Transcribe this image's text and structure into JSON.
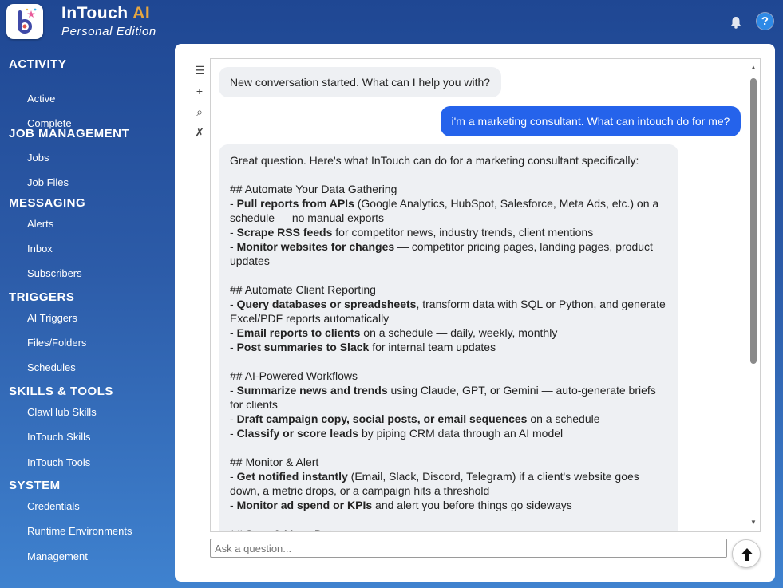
{
  "app": {
    "title": "InTouch",
    "title_ai": "AI",
    "edition": "Personal Edition",
    "help_label": "?",
    "colors": {
      "accent": "#e6a640",
      "user_bubble": "#2563eb",
      "help": "#2e8ae6"
    }
  },
  "sidebar": {
    "sections": [
      {
        "title": "ACTIVITY",
        "items": [
          "Active",
          "Complete"
        ]
      },
      {
        "title": "JOB MANAGEMENT",
        "items": [
          "Jobs",
          "Job Files"
        ]
      },
      {
        "title": "MESSAGING",
        "items": [
          "Alerts",
          "Inbox",
          "Subscribers"
        ]
      },
      {
        "title": "TRIGGERS",
        "items": [
          "AI Triggers",
          "Files/Folders",
          "Schedules"
        ]
      },
      {
        "title": "SKILLS & TOOLS",
        "items": [
          "ClawHub Skills",
          "InTouch Skills",
          "InTouch Tools"
        ]
      },
      {
        "title": "SYSTEM",
        "items": [
          "Credentials",
          "Runtime Environments",
          "Management"
        ]
      }
    ]
  },
  "toolbar": {
    "icons": [
      {
        "name": "menu-icon",
        "glyph": "☰"
      },
      {
        "name": "plus-icon",
        "glyph": "+"
      },
      {
        "name": "search-icon",
        "glyph": "⌕"
      },
      {
        "name": "clear-icon",
        "glyph": "✗"
      }
    ]
  },
  "chat": {
    "system_message": "New conversation started. What can I help you with?",
    "user_message": "i'm a marketing consultant. What can intouch do for me?",
    "ai_lines": [
      [
        {
          "t": "Great question. Here's what InTouch can do for a marketing consultant specifically:"
        }
      ],
      [],
      [
        {
          "t": "## Automate Your Data Gathering"
        }
      ],
      [
        {
          "t": "- "
        },
        {
          "t": "Pull reports from APIs",
          "b": true
        },
        {
          "t": " (Google Analytics, HubSpot, Salesforce, Meta Ads, etc.) on a"
        }
      ],
      [
        {
          "t": "schedule — no manual exports"
        }
      ],
      [
        {
          "t": "- "
        },
        {
          "t": "Scrape RSS feeds",
          "b": true
        },
        {
          "t": " for competitor news, industry trends, client mentions"
        }
      ],
      [
        {
          "t": "- "
        },
        {
          "t": "Monitor websites for changes",
          "b": true
        },
        {
          "t": " — competitor pricing pages, landing pages, product"
        }
      ],
      [
        {
          "t": "updates"
        }
      ],
      [],
      [
        {
          "t": "## Automate Client Reporting"
        }
      ],
      [
        {
          "t": "- "
        },
        {
          "t": "Query databases or spreadsheets",
          "b": true
        },
        {
          "t": ", transform data with SQL or Python, and generate"
        }
      ],
      [
        {
          "t": "Excel/PDF reports automatically"
        }
      ],
      [
        {
          "t": "- "
        },
        {
          "t": "Email reports to clients",
          "b": true
        },
        {
          "t": " on a schedule — daily, weekly, monthly"
        }
      ],
      [
        {
          "t": "- "
        },
        {
          "t": "Post summaries to Slack",
          "b": true
        },
        {
          "t": " for internal team updates"
        }
      ],
      [],
      [
        {
          "t": "## AI-Powered Workflows"
        }
      ],
      [
        {
          "t": "- "
        },
        {
          "t": "Summarize news and trends",
          "b": true
        },
        {
          "t": " using Claude, GPT, or Gemini — auto-generate briefs"
        }
      ],
      [
        {
          "t": "for clients"
        }
      ],
      [
        {
          "t": "- "
        },
        {
          "t": "Draft campaign copy, social posts, or email sequences",
          "b": true
        },
        {
          "t": " on a schedule"
        }
      ],
      [
        {
          "t": "- "
        },
        {
          "t": "Classify or score leads",
          "b": true
        },
        {
          "t": " by piping CRM data through an AI model"
        }
      ],
      [],
      [
        {
          "t": "## Monitor & Alert"
        }
      ],
      [
        {
          "t": "- "
        },
        {
          "t": "Get notified instantly",
          "b": true
        },
        {
          "t": " (Email, Slack, Discord, Telegram) if a client's website goes"
        }
      ],
      [
        {
          "t": "down, a metric drops, or a campaign hits a threshold"
        }
      ],
      [
        {
          "t": "- "
        },
        {
          "t": "Monitor ad spend or KPIs",
          "b": true
        },
        {
          "t": " and alert you before things go sideways"
        }
      ],
      [],
      [
        {
          "t": "## Sync & Move Data"
        }
      ]
    ]
  },
  "input": {
    "placeholder": "Ask a question...",
    "value": ""
  }
}
